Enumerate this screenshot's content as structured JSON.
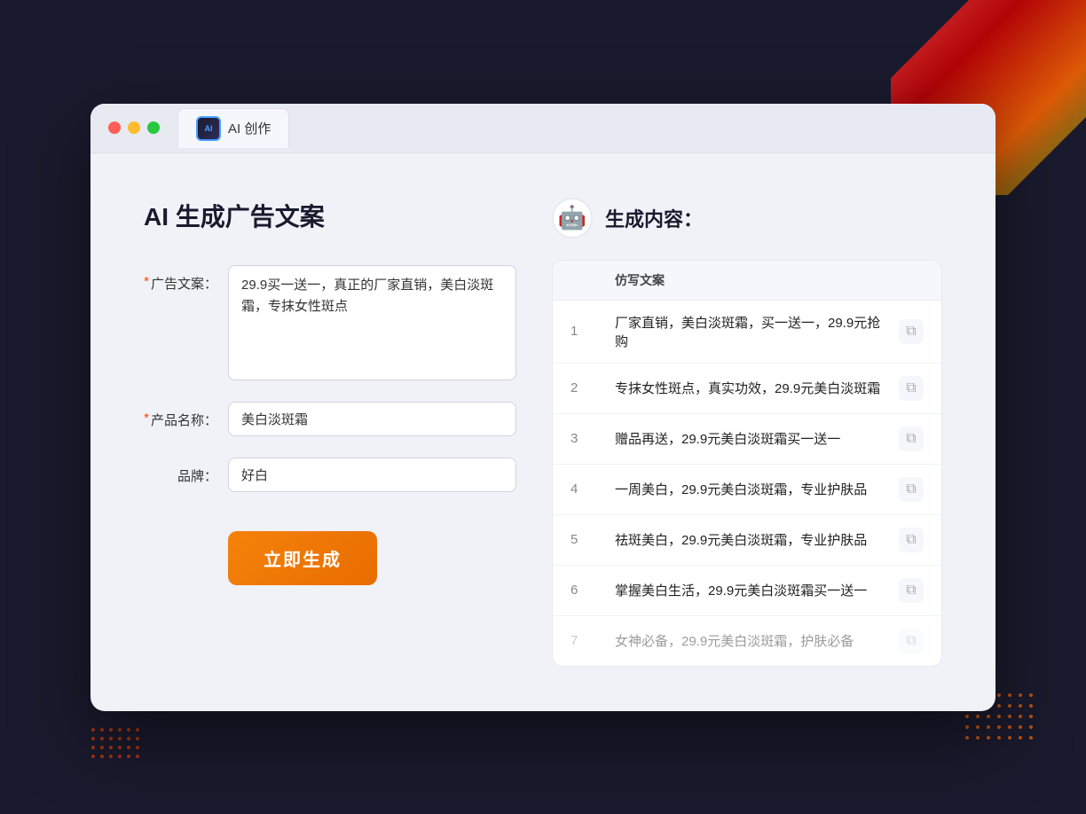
{
  "browser": {
    "tab_label": "AI 创作",
    "tab_icon": "ai-icon"
  },
  "left_panel": {
    "title": "AI 生成广告文案",
    "form": {
      "ad_copy_label": "广告文案：",
      "ad_copy_required": "*",
      "ad_copy_value": "29.9买一送一，真正的厂家直销，美白淡斑霜，专抹女性斑点",
      "product_name_label": "产品名称：",
      "product_name_required": "*",
      "product_name_value": "美白淡斑霜",
      "brand_label": "品牌：",
      "brand_value": "好白",
      "generate_button": "立即生成"
    }
  },
  "right_panel": {
    "title": "生成内容：",
    "table_header": "仿写文案",
    "results": [
      {
        "num": 1,
        "text": "厂家直销，美白淡斑霜，买一送一，29.9元抢购",
        "dimmed": false
      },
      {
        "num": 2,
        "text": "专抹女性斑点，真实功效，29.9元美白淡斑霜",
        "dimmed": false
      },
      {
        "num": 3,
        "text": "赠品再送，29.9元美白淡斑霜买一送一",
        "dimmed": false
      },
      {
        "num": 4,
        "text": "一周美白，29.9元美白淡斑霜，专业护肤品",
        "dimmed": false
      },
      {
        "num": 5,
        "text": "祛斑美白，29.9元美白淡斑霜，专业护肤品",
        "dimmed": false
      },
      {
        "num": 6,
        "text": "掌握美白生活，29.9元美白淡斑霜买一送一",
        "dimmed": false
      },
      {
        "num": 7,
        "text": "女神必备，29.9元美白淡斑霜，护肤必备",
        "dimmed": true
      }
    ]
  }
}
